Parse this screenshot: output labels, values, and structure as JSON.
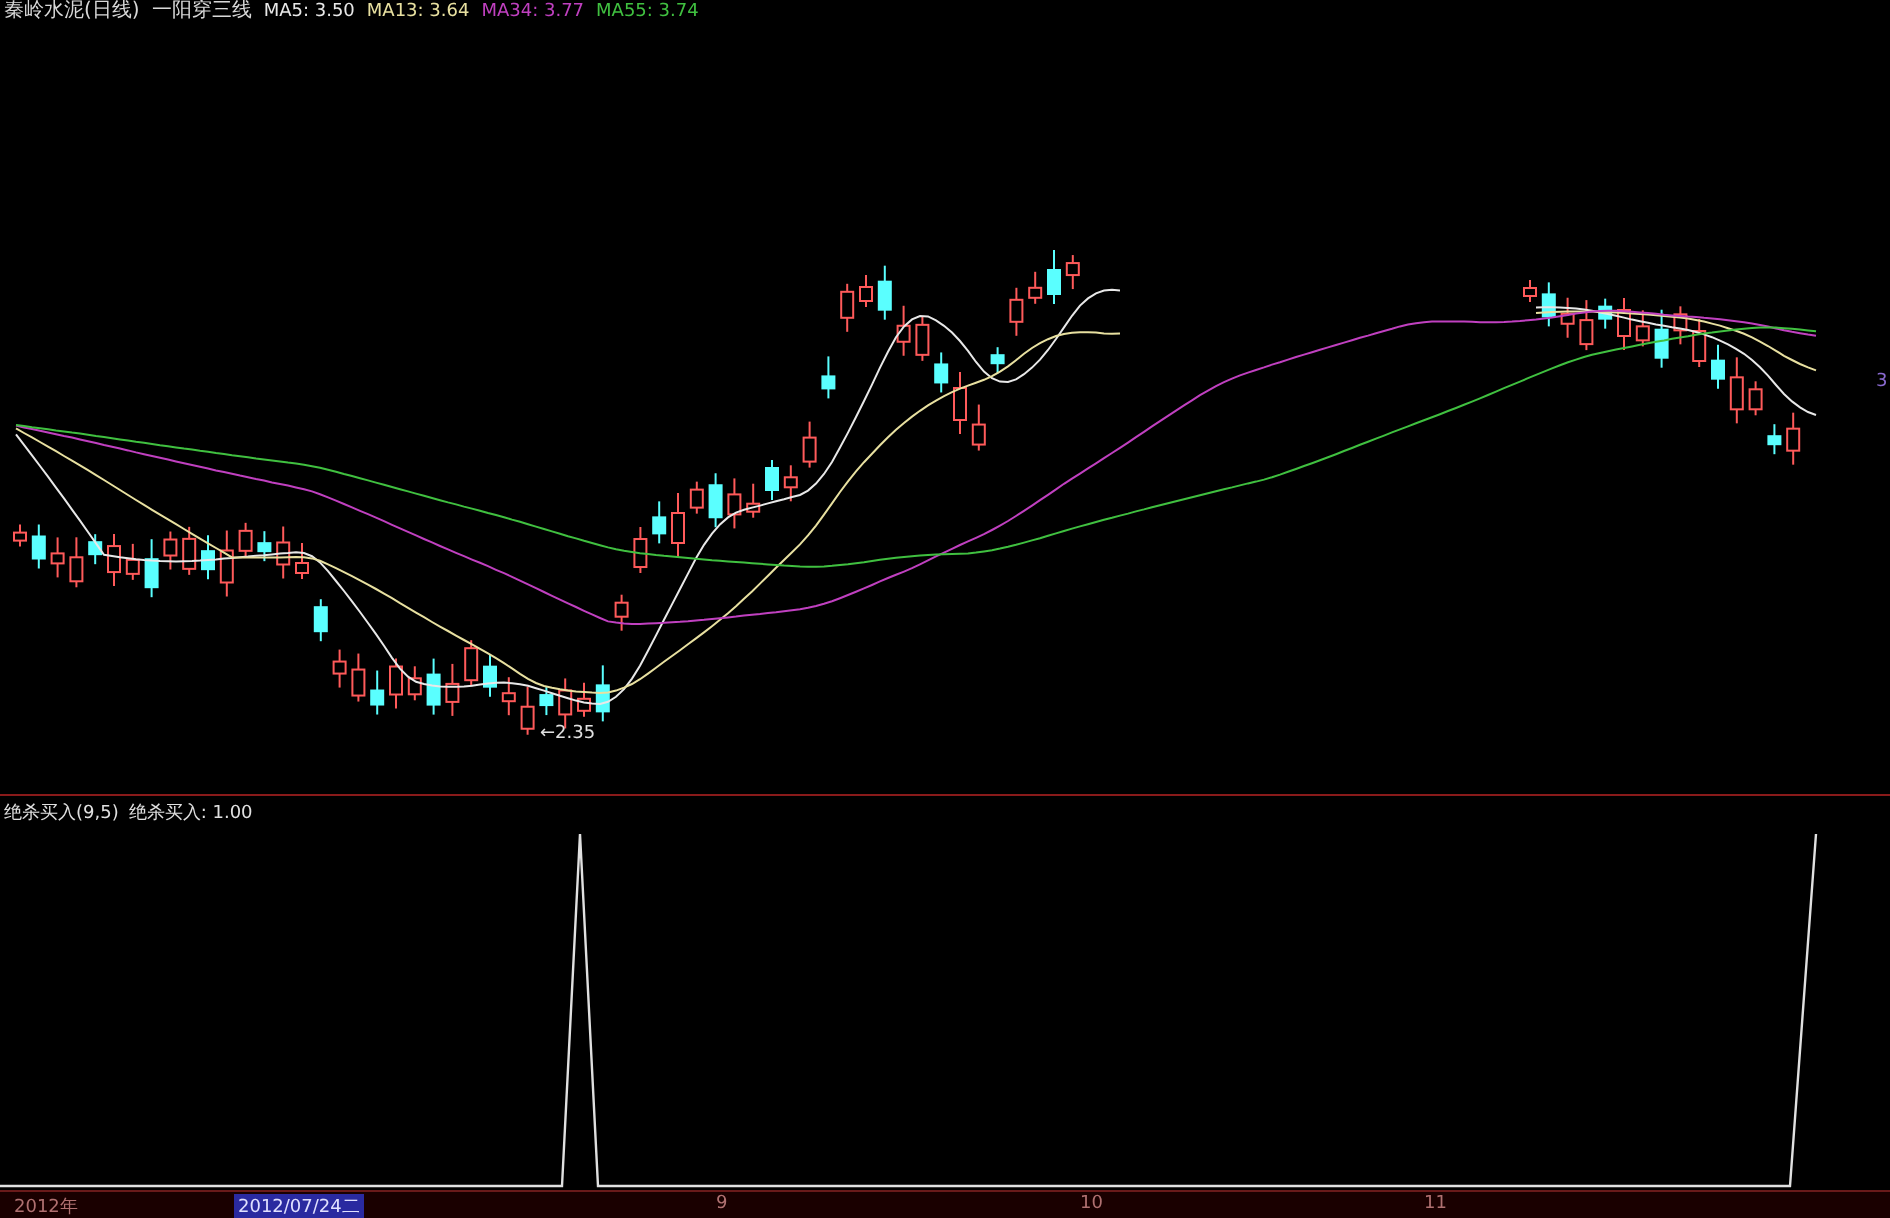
{
  "header": {
    "title": "秦岭水泥(日线)",
    "indicator": "一阳穿三线",
    "averages": [
      {
        "label": "MA5: 3.50",
        "color": "#e8e8e8"
      },
      {
        "label": "MA13: 3.64",
        "color": "#e8e0a0"
      },
      {
        "label": "MA34: 3.77",
        "color": "#c040c0"
      },
      {
        "label": "MA55: 3.74",
        "color": "#40c040"
      }
    ]
  },
  "price_chart": {
    "low_label": "←2.35",
    "right_label": "3"
  },
  "sub_panel": {
    "title": "绝杀买入(9,5)",
    "value": "绝杀买入: 1.00"
  },
  "time_axis": {
    "labels": [
      {
        "text": "2012年",
        "selected": false
      },
      {
        "text": "2012/07/24二",
        "selected": true
      },
      {
        "text": "9",
        "selected": false
      },
      {
        "text": "10",
        "selected": false
      },
      {
        "text": "11",
        "selected": false
      }
    ]
  }
}
